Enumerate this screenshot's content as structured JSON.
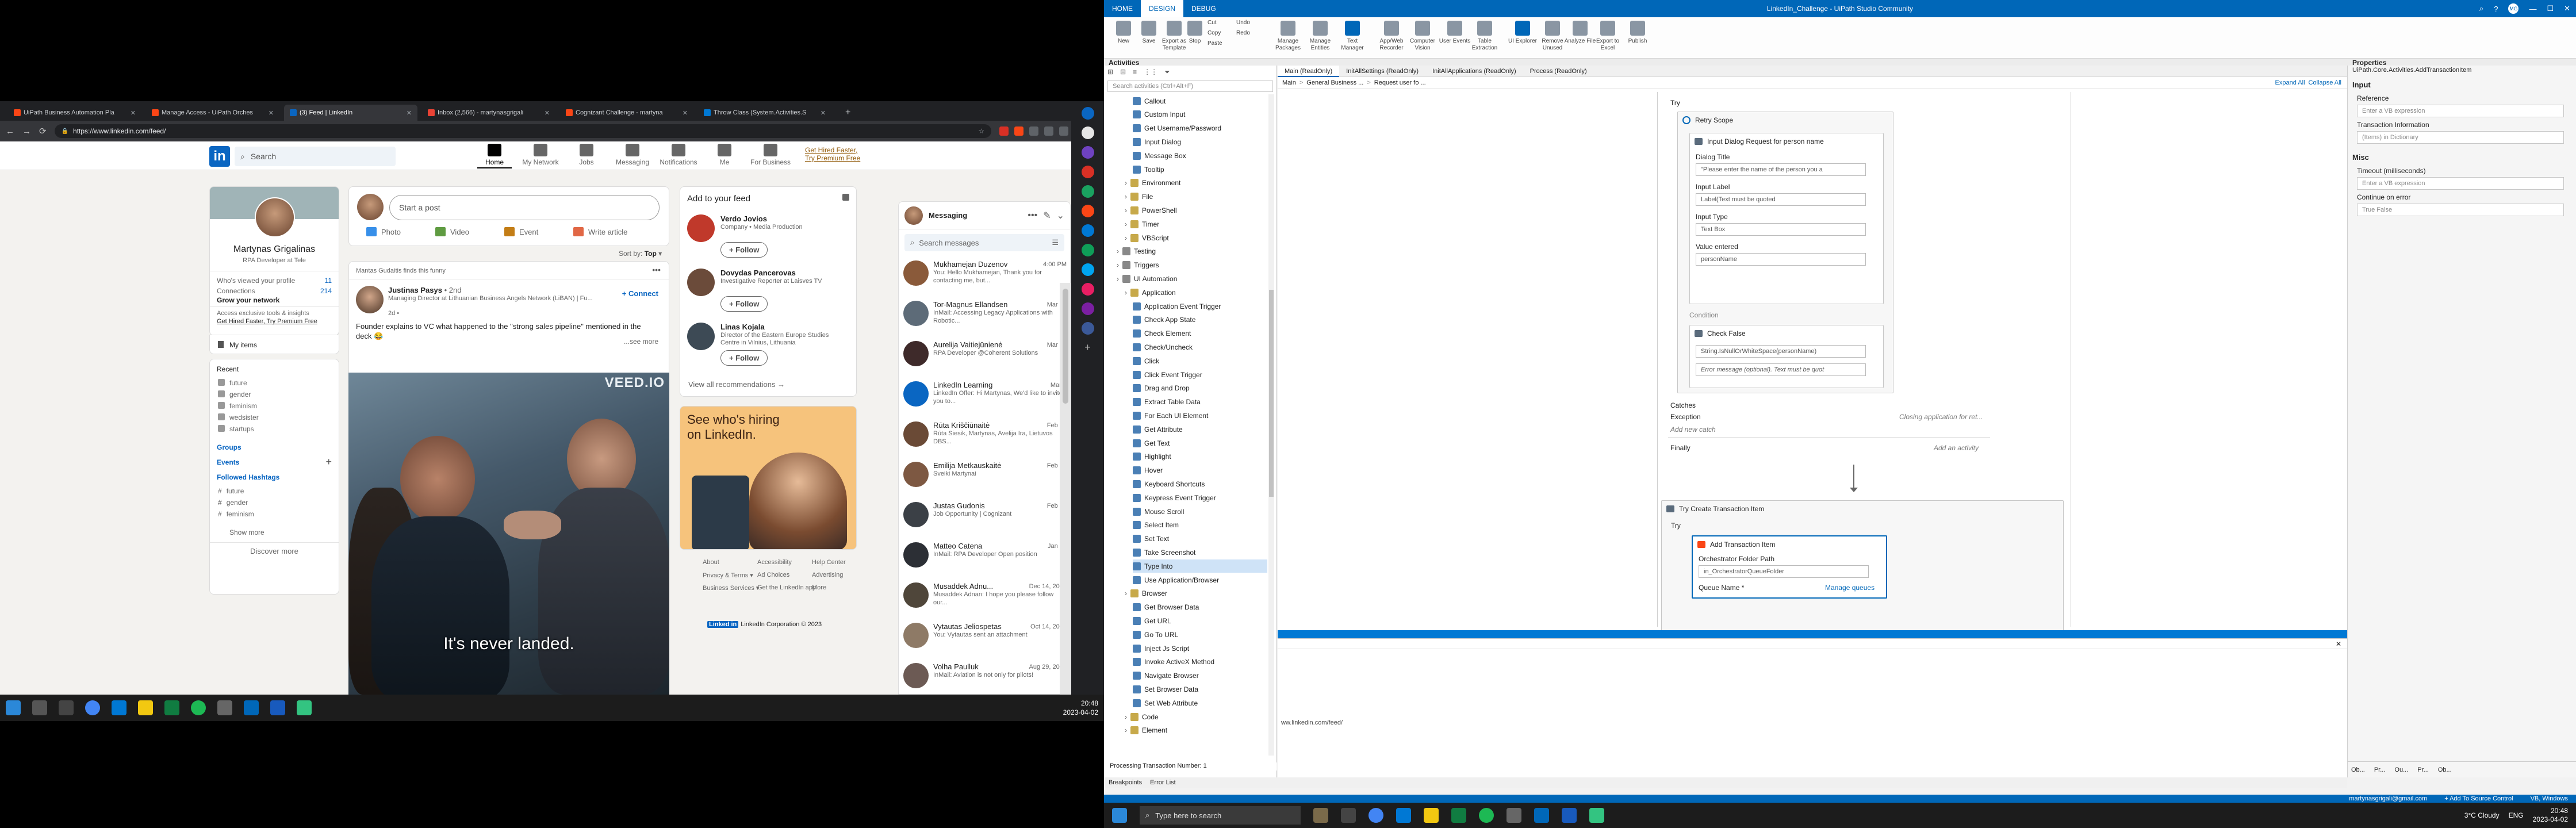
{
  "browser": {
    "tabs": [
      {
        "label": "UiPath Business Automation Pla",
        "color": "#fa4616"
      },
      {
        "label": "Manage Access - UiPath Orches",
        "color": "#fa4616"
      },
      {
        "label": "(3) Feed | LinkedIn",
        "color": "#0a66c2"
      },
      {
        "label": "Inbox (2,566) - martynasgrigali",
        "color": "#ea4335"
      },
      {
        "label": "Cognizant Challenge - martyna",
        "color": "#fa4616"
      },
      {
        "label": "Throw Class (System.Activities.S",
        "color": "#0078d4"
      }
    ],
    "url": "https://www.linkedin.com/feed/"
  },
  "linkedin": {
    "search_placeholder": "Search",
    "nav": [
      "Home",
      "My Network",
      "Jobs",
      "Messaging",
      "Notifications",
      "Me",
      "For Business"
    ],
    "premium": [
      "Get Hired Faster,",
      "Try Premium Free"
    ],
    "profile": {
      "name": "Martynas Grigalinas",
      "title": "RPA Developer at Tele",
      "viewed_label": "Who's viewed your profile",
      "viewed_count": "11",
      "connections_label": "Connections",
      "connections_count": "214",
      "grow": "Grow your network",
      "access": "Access exclusive tools & insights",
      "premium_link": "Get Hired Faster, Try Premium Free",
      "items": "My items"
    },
    "recent": {
      "title": "Recent",
      "items": [
        "future",
        "gender",
        "feminism",
        "wedsister",
        "startups"
      ]
    },
    "groups": "Groups",
    "events": "Events",
    "hashtags": {
      "title": "Followed Hashtags",
      "items": [
        "future",
        "gender",
        "feminism"
      ]
    },
    "show_more": "Show more",
    "discover": "Discover more",
    "post_box": {
      "placeholder": "Start a post",
      "photo": "Photo",
      "video": "Video",
      "event": "Event",
      "article": "Write article"
    },
    "sort": "Sort by:",
    "sort_value": "Top",
    "feed_post": {
      "finds": "Mantas Gudaitis finds this funny",
      "author": "Justinas Pasys",
      "degree": "• 2nd",
      "subtitle": "Managing Director at Lithuanian Business Angels Network (LiBAN) | Fu...",
      "time": "2d •",
      "connect": "Connect",
      "text": "Founder explains to VC what happened to the \"strong sales pipeline\" mentioned in the deck 😂",
      "see_more": "...see more",
      "caption": "It's never landed.",
      "watermark": "VEED.IO"
    },
    "add_feed": {
      "title": "Add to your feed",
      "people": [
        {
          "name": "Verdo Jovios",
          "desc": "Company • Media Production"
        },
        {
          "name": "Dovydas Pancerovas",
          "desc": "Investigative Reporter at Laisves TV"
        },
        {
          "name": "Linas Kojala",
          "desc": "Director of the Eastern Europe Studies Centre in Vilnius, Lithuania"
        }
      ],
      "follow": "+ Follow",
      "all": "View all recommendations →"
    },
    "ad": {
      "line1": "See who's hiring",
      "line2": "on LinkedIn."
    },
    "footer": [
      "About",
      "Accessibility",
      "Help Center",
      "Privacy & Terms ▾",
      "Ad Choices",
      "Advertising",
      "Business Services ▾",
      "Get the LinkedIn app",
      "More"
    ],
    "copyright": "LinkedIn Corporation © 2023",
    "messaging": {
      "title": "Messaging",
      "search": "Search messages",
      "items": [
        {
          "name": "Mukhamejan Duzenov",
          "date": "4:00 PM",
          "text": "You: Hello Mukhamejan, Thank you for contacting me, but...",
          "color": "#8a5a3a"
        },
        {
          "name": "Tor-Magnus Ellandsen",
          "date": "Mar 27",
          "text": "InMail: Accessing Legacy Applications with Robotic...",
          "color": "#5d6b78"
        },
        {
          "name": "Aurelija Vaitiejūnienė",
          "date": "Mar 20",
          "text": "RPA Developer @Coherent Solutions",
          "color": "#3e2a2a"
        },
        {
          "name": "LinkedIn Learning",
          "date": "Mar 3",
          "text": "LinkedIn Offer: Hi Martynas, We'd like to invite you to...",
          "color": "#0a66c2"
        },
        {
          "name": "Rūta Kriščiūnaitė",
          "date": "Feb 27",
          "text": "Rūta Siesik, Martynas, Avelija Ira, Lietuvos DBS...",
          "color": "#6a4a36"
        },
        {
          "name": "Emilija Metkauskaitė",
          "date": "Feb 24",
          "text": "Sveiki Martynai",
          "color": "#7d5842"
        },
        {
          "name": "Justas Gudonis",
          "date": "Feb 22",
          "text": "Job Opportunity | Cognizant",
          "color": "#3b4046"
        },
        {
          "name": "Matteo Catena",
          "date": "Jan 10",
          "text": "InMail: RPA Developer Open position",
          "color": "#2c2f35"
        },
        {
          "name": "Musaddek Adnu...",
          "date": "Dec 14, 2022",
          "text": "Musaddek Adnan: I hope you please follow our...",
          "color": "#4f463a"
        },
        {
          "name": "Vytautas Jeliospetas",
          "date": "Oct 14, 2022",
          "text": "You: Vytautas sent an attachment",
          "color": "#8e7a66"
        },
        {
          "name": "Volha Paulluk",
          "date": "Aug 29, 2022",
          "text": "InMail: Aviation is not only for pilots!",
          "color": "#6c5a54"
        }
      ]
    }
  },
  "left_clock": {
    "time": "20:48",
    "date": "2023-04-02"
  },
  "studio": {
    "title": "LinkedIn_Challenge - UiPath Studio Community",
    "menu": [
      "HOME",
      "DESIGN",
      "DEBUG"
    ],
    "ribbon": [
      "New",
      "Save",
      "Export as Template",
      "Stop",
      "Cut",
      "Copy",
      "Paste",
      "Undo",
      "Redo",
      "Manage Packages",
      "Manage Entities",
      "Text Manager",
      "App/Web Recorder",
      "Computer Vision",
      "User Events",
      "Table Extraction",
      "UI Explorer",
      "Remove Unused",
      "Analyze File",
      "Export to Excel",
      "Publish"
    ],
    "activities": {
      "title": "Activities",
      "search": "Search activities (Ctrl+Alt+F)",
      "items": [
        {
          "label": "Callout",
          "lvl": 3
        },
        {
          "label": "Custom Input",
          "lvl": 3
        },
        {
          "label": "Get Username/Password",
          "lvl": 3
        },
        {
          "label": "Input Dialog",
          "lvl": 3
        },
        {
          "label": "Message Box",
          "lvl": 3
        },
        {
          "label": "Tooltip",
          "lvl": 3
        },
        {
          "label": "Environment",
          "lvl": 2
        },
        {
          "label": "File",
          "lvl": 2
        },
        {
          "label": "PowerShell",
          "lvl": 2
        },
        {
          "label": "Timer",
          "lvl": 2
        },
        {
          "label": "VBScript",
          "lvl": 2
        },
        {
          "label": "Testing",
          "lvl": 1
        },
        {
          "label": "Triggers",
          "lvl": 1
        },
        {
          "label": "UI Automation",
          "lvl": 1
        },
        {
          "label": "Application",
          "lvl": 2
        },
        {
          "label": "Application Event Trigger",
          "lvl": 3
        },
        {
          "label": "Check App State",
          "lvl": 3
        },
        {
          "label": "Check Element",
          "lvl": 3
        },
        {
          "label": "Check/Uncheck",
          "lvl": 3
        },
        {
          "label": "Click",
          "lvl": 3
        },
        {
          "label": "Click Event Trigger",
          "lvl": 3
        },
        {
          "label": "Drag and Drop",
          "lvl": 3
        },
        {
          "label": "Extract Table Data",
          "lvl": 3
        },
        {
          "label": "For Each UI Element",
          "lvl": 3
        },
        {
          "label": "Get Attribute",
          "lvl": 3
        },
        {
          "label": "Get Text",
          "lvl": 3
        },
        {
          "label": "Highlight",
          "lvl": 3
        },
        {
          "label": "Hover",
          "lvl": 3
        },
        {
          "label": "Keyboard Shortcuts",
          "lvl": 3
        },
        {
          "label": "Keypress Event Trigger",
          "lvl": 3
        },
        {
          "label": "Mouse Scroll",
          "lvl": 3
        },
        {
          "label": "Select Item",
          "lvl": 3
        },
        {
          "label": "Set Text",
          "lvl": 3
        },
        {
          "label": "Take Screenshot",
          "lvl": 3
        },
        {
          "label": "Type Into",
          "lvl": 3
        },
        {
          "label": "Use Application/Browser",
          "lvl": 3
        },
        {
          "label": "Browser",
          "lvl": 2
        },
        {
          "label": "Get Browser Data",
          "lvl": 3
        },
        {
          "label": "Get URL",
          "lvl": 3
        },
        {
          "label": "Go To URL",
          "lvl": 3
        },
        {
          "label": "Inject Js Script",
          "lvl": 3
        },
        {
          "label": "Invoke ActiveX Method",
          "lvl": 3
        },
        {
          "label": "Navigate Browser",
          "lvl": 3
        },
        {
          "label": "Set Browser Data",
          "lvl": 3
        },
        {
          "label": "Set Web Attribute",
          "lvl": 3
        },
        {
          "label": "Code",
          "lvl": 2
        },
        {
          "label": "Element",
          "lvl": 2
        }
      ],
      "selected": "Type Into"
    },
    "doc_tabs": [
      "Main (ReadOnly)",
      "InitAllSettings (ReadOnly)",
      "InitAllApplications (ReadOnly)",
      "Process (ReadOnly)"
    ],
    "breadcrumb": [
      "Main",
      "General Business ...",
      "Request user fo ..."
    ],
    "expand_all": "Expand All",
    "collapse_all": "Collapse All",
    "workflow": {
      "try1": "Try",
      "retry": "Retry Scope",
      "input_dialog": "Input Dialog Request for person name",
      "dialog_title_l": "Dialog Title",
      "dialog_title_v": "\"Please enter the name of the person you a",
      "input_label_l": "Input Label",
      "input_label_v": "Label(Text must be quoted",
      "input_type_l": "Input Type",
      "input_type_v": "Text Box",
      "value_entered_l": "Value entered",
      "value_entered_v": "personName",
      "condition": "Condition",
      "check_false": "Check False",
      "check_expr": "String.IsNullOrWhiteSpace(personName)",
      "error_msg": "Error message (optional). Text must be quot",
      "catches": "Catches",
      "exception": "Exception",
      "exception_v": "Closing application for ret...",
      "add_catch": "Add new catch",
      "finally": "Finally",
      "add_activity": "Add an activity",
      "try_create": "Try Create Transaction Item",
      "try2": "Try",
      "add_txn": "Add Transaction Item",
      "orch_folder_l": "Orchestrator Folder Path",
      "orch_folder_v": "in_OrchestratorQueueFolder",
      "queue_name_l": "Queue Name *",
      "manage_queues": "Manage queues"
    },
    "output_url": "ww.linkedin.com/feed/",
    "proc_txn": "Processing Transaction Number: 1",
    "bottom_tabs": [
      "Breakpoints",
      "Error List"
    ],
    "properties": {
      "title": "Properties",
      "type": "UiPath.Core.Activities.AddTransactionItem",
      "sections": [
        {
          "name": "Input",
          "fields": [
            {
              "label": "Reference",
              "value": "Enter a VB expression"
            },
            {
              "label": "Transaction Information",
              "value": "(Items) in Dictionary"
            }
          ]
        },
        {
          "name": "Misc",
          "fields": [
            {
              "label": "Timeout (milliseconds)",
              "value": "Enter a VB expression"
            },
            {
              "label": "Continue on error",
              "value": "True    False"
            }
          ]
        }
      ],
      "bottom_tabs": [
        "Ob...",
        "Pr...",
        "Ou...",
        "Pr...",
        "Ob..."
      ]
    },
    "status": {
      "user": "martynasgrigali@gmail.com",
      "source": "+ Add To Source Control",
      "lang": "VB, Windows"
    }
  },
  "right_task": {
    "search": "Type here to search",
    "weather": "3°C Cloudy",
    "lang": "ENG",
    "time": "20:48",
    "date": "2023-04-02"
  }
}
